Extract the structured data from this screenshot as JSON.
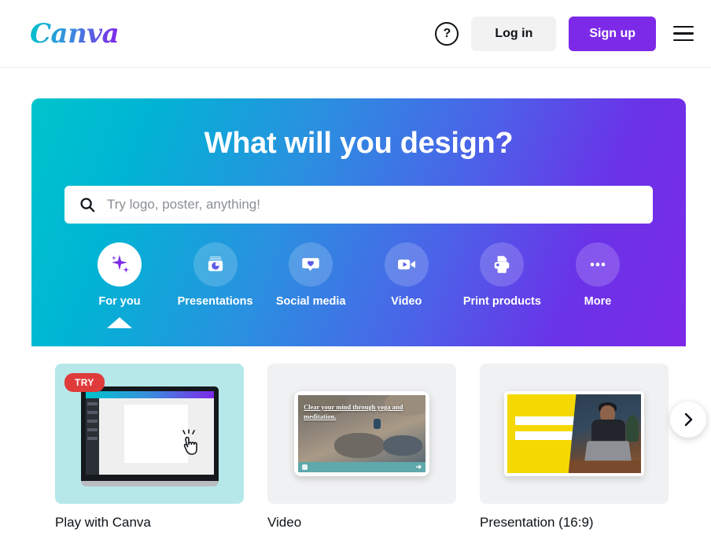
{
  "header": {
    "logo_text": "Canva",
    "help_label": "?",
    "login_label": "Log in",
    "signup_label": "Sign up",
    "menu_label": "Menu"
  },
  "hero": {
    "title": "What will you design?",
    "search_placeholder": "Try logo, poster, anything!",
    "search_value": "",
    "gradient_start": "#00c4cc",
    "gradient_end": "#7d2ae8",
    "categories": [
      {
        "label": "For you",
        "icon": "sparkle-icon",
        "active": true
      },
      {
        "label": "Presentations",
        "icon": "presentation-icon",
        "active": false
      },
      {
        "label": "Social media",
        "icon": "heart-chat-icon",
        "active": false
      },
      {
        "label": "Video",
        "icon": "video-camera-icon",
        "active": false
      },
      {
        "label": "Print products",
        "icon": "printer-icon",
        "active": false
      },
      {
        "label": "More",
        "icon": "ellipsis-icon",
        "active": false
      }
    ]
  },
  "cards": [
    {
      "label": "Play with Canva",
      "badge": "TRY",
      "badge_color": "#e03b3b",
      "thumb_background": "#b6e8ea"
    },
    {
      "label": "Video",
      "badge": "",
      "thumb_background": "#f0f1f2",
      "artwork_text": "Clear your mind through yoga and meditation."
    },
    {
      "label": "Presentation (16:9)",
      "badge": "",
      "thumb_background": "#f0f1f2",
      "artwork_accent": "#f5d800"
    }
  ],
  "carousel": {
    "next_label": "›"
  }
}
